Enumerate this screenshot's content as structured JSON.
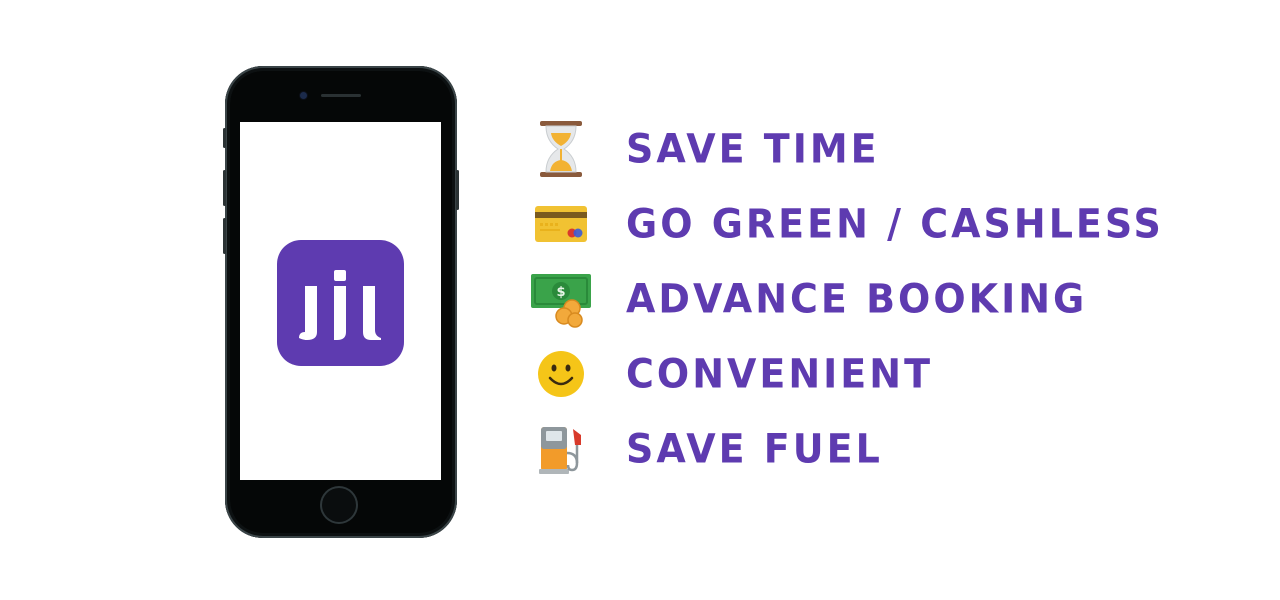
{
  "colors": {
    "brand_purple": "#5e3bb0",
    "phone_body": "#1d2426",
    "background": "#ffffff"
  },
  "phone": {
    "app_icon": "app-logo-icon"
  },
  "features": [
    {
      "icon": "hourglass-icon",
      "label": "SAVE TIME"
    },
    {
      "icon": "credit-card-icon",
      "label": "GO GREEN / CASHLESS"
    },
    {
      "icon": "money-coins-icon",
      "label": "ADVANCE BOOKING"
    },
    {
      "icon": "smiley-face-icon",
      "label": "CONVENIENT"
    },
    {
      "icon": "fuel-pump-icon",
      "label": "SAVE FUEL"
    }
  ]
}
